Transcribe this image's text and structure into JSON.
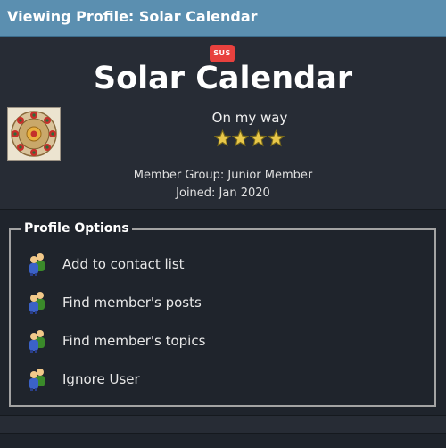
{
  "header": {
    "title": "Viewing Profile: Solar Calendar",
    "accent_color": "#5b8fb0"
  },
  "profile": {
    "badge": "SUS",
    "badge_color": "#e8413e",
    "username": "Solar Calendar",
    "status": "On my way",
    "rating_stars": 4,
    "member_group": "Member Group: Junior Member",
    "joined": "Joined: Jan 2020",
    "avatar_icon": "solar-calendar-avatar"
  },
  "options": {
    "legend": "Profile Options",
    "items": [
      {
        "label": "Add to contact list",
        "icon": "users-icon"
      },
      {
        "label": "Find member's posts",
        "icon": "users-icon"
      },
      {
        "label": "Find member's topics",
        "icon": "users-icon"
      },
      {
        "label": "Ignore User",
        "icon": "users-icon"
      }
    ]
  }
}
